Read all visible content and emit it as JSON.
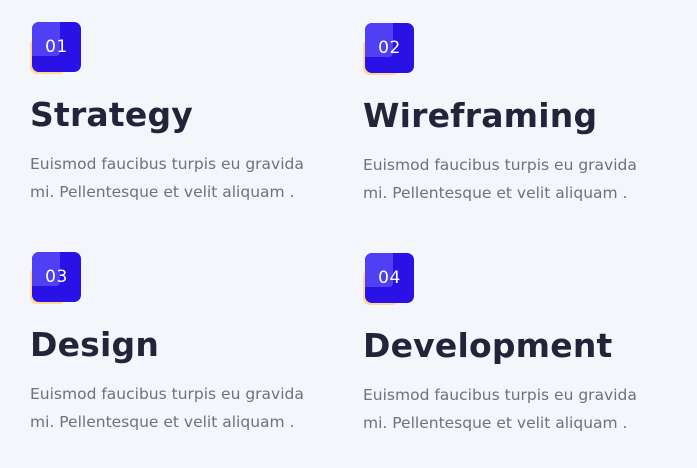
{
  "features": [
    {
      "number": "01",
      "title": "Strategy",
      "description": "Euismod faucibus turpis eu gravida mi. Pellentesque et velit aliquam ."
    },
    {
      "number": "02",
      "title": "Wireframing",
      "description": "Euismod faucibus turpis eu gravida mi. Pellentesque et velit aliquam ."
    },
    {
      "number": "03",
      "title": "Design",
      "description": "Euismod faucibus turpis eu gravida mi. Pellentesque et velit aliquam ."
    },
    {
      "number": "04",
      "title": "Development",
      "description": "Euismod faucibus turpis eu gravida mi. Pellentesque et velit aliquam ."
    }
  ],
  "colors": {
    "badge_primary": "#2a12e6",
    "badge_highlight": "#5040f4",
    "badge_accent": "#ffd991",
    "background": "#f5f6fb",
    "title_text": "#23233a",
    "body_text": "#6f7080"
  }
}
